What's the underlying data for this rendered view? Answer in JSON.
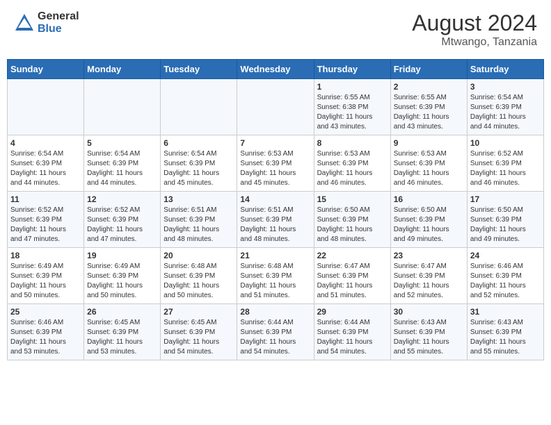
{
  "header": {
    "logo_general": "General",
    "logo_blue": "Blue",
    "month_year": "August 2024",
    "location": "Mtwango, Tanzania"
  },
  "weekdays": [
    "Sunday",
    "Monday",
    "Tuesday",
    "Wednesday",
    "Thursday",
    "Friday",
    "Saturday"
  ],
  "weeks": [
    [
      {
        "day": "",
        "info": ""
      },
      {
        "day": "",
        "info": ""
      },
      {
        "day": "",
        "info": ""
      },
      {
        "day": "",
        "info": ""
      },
      {
        "day": "1",
        "info": "Sunrise: 6:55 AM\nSunset: 6:38 PM\nDaylight: 11 hours\nand 43 minutes."
      },
      {
        "day": "2",
        "info": "Sunrise: 6:55 AM\nSunset: 6:39 PM\nDaylight: 11 hours\nand 43 minutes."
      },
      {
        "day": "3",
        "info": "Sunrise: 6:54 AM\nSunset: 6:39 PM\nDaylight: 11 hours\nand 44 minutes."
      }
    ],
    [
      {
        "day": "4",
        "info": "Sunrise: 6:54 AM\nSunset: 6:39 PM\nDaylight: 11 hours\nand 44 minutes."
      },
      {
        "day": "5",
        "info": "Sunrise: 6:54 AM\nSunset: 6:39 PM\nDaylight: 11 hours\nand 44 minutes."
      },
      {
        "day": "6",
        "info": "Sunrise: 6:54 AM\nSunset: 6:39 PM\nDaylight: 11 hours\nand 45 minutes."
      },
      {
        "day": "7",
        "info": "Sunrise: 6:53 AM\nSunset: 6:39 PM\nDaylight: 11 hours\nand 45 minutes."
      },
      {
        "day": "8",
        "info": "Sunrise: 6:53 AM\nSunset: 6:39 PM\nDaylight: 11 hours\nand 46 minutes."
      },
      {
        "day": "9",
        "info": "Sunrise: 6:53 AM\nSunset: 6:39 PM\nDaylight: 11 hours\nand 46 minutes."
      },
      {
        "day": "10",
        "info": "Sunrise: 6:52 AM\nSunset: 6:39 PM\nDaylight: 11 hours\nand 46 minutes."
      }
    ],
    [
      {
        "day": "11",
        "info": "Sunrise: 6:52 AM\nSunset: 6:39 PM\nDaylight: 11 hours\nand 47 minutes."
      },
      {
        "day": "12",
        "info": "Sunrise: 6:52 AM\nSunset: 6:39 PM\nDaylight: 11 hours\nand 47 minutes."
      },
      {
        "day": "13",
        "info": "Sunrise: 6:51 AM\nSunset: 6:39 PM\nDaylight: 11 hours\nand 48 minutes."
      },
      {
        "day": "14",
        "info": "Sunrise: 6:51 AM\nSunset: 6:39 PM\nDaylight: 11 hours\nand 48 minutes."
      },
      {
        "day": "15",
        "info": "Sunrise: 6:50 AM\nSunset: 6:39 PM\nDaylight: 11 hours\nand 48 minutes."
      },
      {
        "day": "16",
        "info": "Sunrise: 6:50 AM\nSunset: 6:39 PM\nDaylight: 11 hours\nand 49 minutes."
      },
      {
        "day": "17",
        "info": "Sunrise: 6:50 AM\nSunset: 6:39 PM\nDaylight: 11 hours\nand 49 minutes."
      }
    ],
    [
      {
        "day": "18",
        "info": "Sunrise: 6:49 AM\nSunset: 6:39 PM\nDaylight: 11 hours\nand 50 minutes."
      },
      {
        "day": "19",
        "info": "Sunrise: 6:49 AM\nSunset: 6:39 PM\nDaylight: 11 hours\nand 50 minutes."
      },
      {
        "day": "20",
        "info": "Sunrise: 6:48 AM\nSunset: 6:39 PM\nDaylight: 11 hours\nand 50 minutes."
      },
      {
        "day": "21",
        "info": "Sunrise: 6:48 AM\nSunset: 6:39 PM\nDaylight: 11 hours\nand 51 minutes."
      },
      {
        "day": "22",
        "info": "Sunrise: 6:47 AM\nSunset: 6:39 PM\nDaylight: 11 hours\nand 51 minutes."
      },
      {
        "day": "23",
        "info": "Sunrise: 6:47 AM\nSunset: 6:39 PM\nDaylight: 11 hours\nand 52 minutes."
      },
      {
        "day": "24",
        "info": "Sunrise: 6:46 AM\nSunset: 6:39 PM\nDaylight: 11 hours\nand 52 minutes."
      }
    ],
    [
      {
        "day": "25",
        "info": "Sunrise: 6:46 AM\nSunset: 6:39 PM\nDaylight: 11 hours\nand 53 minutes."
      },
      {
        "day": "26",
        "info": "Sunrise: 6:45 AM\nSunset: 6:39 PM\nDaylight: 11 hours\nand 53 minutes."
      },
      {
        "day": "27",
        "info": "Sunrise: 6:45 AM\nSunset: 6:39 PM\nDaylight: 11 hours\nand 54 minutes."
      },
      {
        "day": "28",
        "info": "Sunrise: 6:44 AM\nSunset: 6:39 PM\nDaylight: 11 hours\nand 54 minutes."
      },
      {
        "day": "29",
        "info": "Sunrise: 6:44 AM\nSunset: 6:39 PM\nDaylight: 11 hours\nand 54 minutes."
      },
      {
        "day": "30",
        "info": "Sunrise: 6:43 AM\nSunset: 6:39 PM\nDaylight: 11 hours\nand 55 minutes."
      },
      {
        "day": "31",
        "info": "Sunrise: 6:43 AM\nSunset: 6:39 PM\nDaylight: 11 hours\nand 55 minutes."
      }
    ]
  ]
}
